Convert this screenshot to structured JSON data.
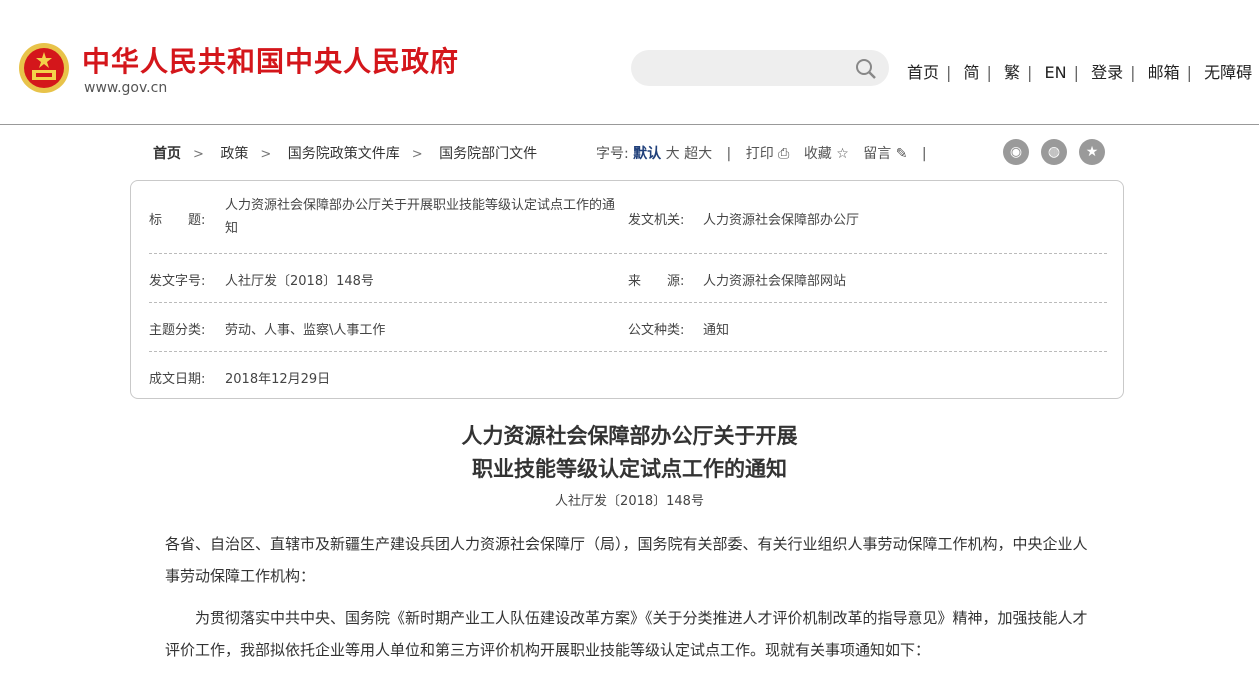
{
  "site": {
    "title": "中华人民共和国中央人民政府",
    "domain": "www.gov.cn"
  },
  "search": {
    "placeholder": ""
  },
  "topnav": [
    "首页",
    "简",
    "繁",
    "EN",
    "登录",
    "邮箱",
    "无障碍"
  ],
  "breadcrumb": [
    "首页",
    "政策",
    "国务院政策文件库",
    "国务院部门文件"
  ],
  "tools": {
    "font_label": "字号:",
    "font_default": "默认",
    "font_large": "大",
    "font_xlarge": "超大",
    "print": "打印",
    "favorite": "收藏",
    "comment": "留言",
    "sep": "|"
  },
  "meta": {
    "title_label": "标　　题:",
    "title_value": "人力资源社会保障部办公厅关于开展职业技能等级认定试点工作的通知",
    "issuer_label": "发文机关:",
    "issuer_value": "人力资源社会保障部办公厅",
    "docno_label": "发文字号:",
    "docno_value": "人社厅发〔2018〕148号",
    "source_label": "来　　源:",
    "source_value": "人力资源社会保障部网站",
    "topic_label": "主题分类:",
    "topic_value": "劳动、人事、监察\\人事工作",
    "kind_label": "公文种类:",
    "kind_value": "通知",
    "date_label": "成文日期:",
    "date_value": "2018年12月29日"
  },
  "document": {
    "title_line1": "人力资源社会保障部办公厅关于开展",
    "title_line2": "职业技能等级认定试点工作的通知",
    "number": "人社厅发〔2018〕148号",
    "para1": "各省、自治区、直辖市及新疆生产建设兵团人力资源社会保障厅（局），国务院有关部委、有关行业组织人事劳动保障工作机构，中央企业人事劳动保障工作机构：",
    "para2": "　　为贯彻落实中共中央、国务院《新时期产业工人队伍建设改革方案》《关于分类推进人才评价机制改革的指导意见》精神，加强技能人才评价工作，我部拟依托企业等用人单位和第三方评价机构开展职业技能等级认定试点工作。现就有关事项通知如下："
  },
  "colors": {
    "brand_red": "#d4161b",
    "active_blue": "#1f3f7a"
  }
}
